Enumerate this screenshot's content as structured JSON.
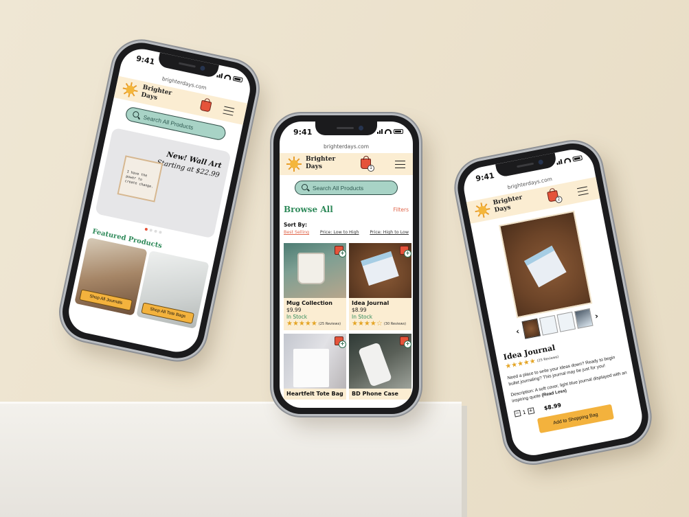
{
  "time": "9:41",
  "url": "brighterdays.com",
  "brand": {
    "line1": "Brighter",
    "line2": "Days"
  },
  "cart_count": "1",
  "cart_count_right": "2",
  "search_placeholder": "Search All Products",
  "home": {
    "hero_title": "New! Wall Art",
    "hero_subtitle": "Starting at $22.99",
    "art_text": "I have the power to create change.",
    "featured_heading": "Featured Products",
    "shop_journals": "Shop All Journals",
    "shop_totes": "Shop All Tote Bags"
  },
  "browse": {
    "heading": "Browse All",
    "filters": "Filters",
    "sort_by": "Sort By:",
    "sort_options": [
      "Best Selling",
      "Price: Low to High",
      "Price: High to Low"
    ],
    "products": [
      {
        "name": "Mug Collection",
        "price": "$9.99",
        "stock": "In Stock",
        "reviews": "(25 Reviews)"
      },
      {
        "name": "Idea Journal",
        "price": "$8.99",
        "stock": "In Stock",
        "reviews": "(30 Reviews)"
      },
      {
        "name": "Heartfelt Tote Bag"
      },
      {
        "name": "BD Phone Case"
      }
    ]
  },
  "detail": {
    "title": "Idea Journal",
    "reviews": "(25 Reviews)",
    "desc1": "Need a place to write your ideas down? Ready to begin bullet journaling? This journal may be just for you!",
    "desc2": "Description: A soft cover, light blue journal displayed with an inspiring quote",
    "read_less": "(Read Less)",
    "qty": "1",
    "price": "$8.99",
    "add_button": "Add to Shopping Bag"
  },
  "colors": {
    "accent_green": "#2f8a5a",
    "accent_orange": "#e0654a",
    "cream": "#fbedd2",
    "button_yellow": "#f3b23d"
  }
}
